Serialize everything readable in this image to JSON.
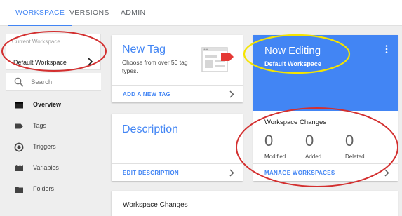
{
  "tabs": [
    {
      "label": "WORKSPACE",
      "active": true
    },
    {
      "label": "VERSIONS",
      "active": false
    },
    {
      "label": "ADMIN",
      "active": false
    }
  ],
  "sidebar": {
    "workspace_label": "Current Workspace",
    "workspace_name": "Default Workspace",
    "search_placeholder": "Search",
    "items": [
      {
        "label": "Overview",
        "icon": "overview-icon",
        "active": true
      },
      {
        "label": "Tags",
        "icon": "tag-icon",
        "active": false
      },
      {
        "label": "Triggers",
        "icon": "trigger-icon",
        "active": false
      },
      {
        "label": "Variables",
        "icon": "variables-icon",
        "active": false
      },
      {
        "label": "Folders",
        "icon": "folder-icon",
        "active": false
      }
    ]
  },
  "new_tag_card": {
    "title": "New Tag",
    "subtitle": "Choose from over 50 tag types.",
    "link": "ADD A NEW TAG"
  },
  "description_card": {
    "title": "Description",
    "link": "EDIT DESCRIPTION"
  },
  "editing_card": {
    "title": "Now Editing",
    "workspace": "Default Workspace",
    "changes_title": "Workspace Changes",
    "stats": [
      {
        "value": "0",
        "label": "Modified"
      },
      {
        "value": "0",
        "label": "Added"
      },
      {
        "value": "0",
        "label": "Deleted"
      }
    ],
    "link": "MANAGE WORKSPACES"
  },
  "bottom_card": {
    "title": "Workspace Changes"
  },
  "colors": {
    "accent": "#4285f4",
    "annotation_red": "#d32f2f",
    "annotation_yellow": "#f5e400"
  }
}
